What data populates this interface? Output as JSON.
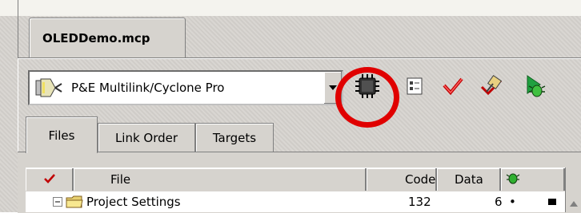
{
  "project_tab": {
    "label": "OLEDDemo.mcp"
  },
  "connection": {
    "selected": "P&E Multilink/Cyclone Pro"
  },
  "toolbar": {
    "buttons": [
      {
        "icon": "chip-icon",
        "label": ""
      },
      {
        "icon": "settings-list-icon",
        "label": ""
      },
      {
        "icon": "checkmark-icon",
        "label": ""
      },
      {
        "icon": "make-icon",
        "label": ""
      },
      {
        "icon": "debug-icon",
        "label": ""
      }
    ]
  },
  "tabs": [
    {
      "label": "Files",
      "active": true
    },
    {
      "label": "Link Order",
      "active": false
    },
    {
      "label": "Targets",
      "active": false
    }
  ],
  "table": {
    "columns": {
      "check": "",
      "file": "File",
      "code": "Code",
      "data": "Data"
    },
    "rows": [
      {
        "file": "Project Settings",
        "code": "132",
        "data": "6",
        "dot": "•"
      }
    ]
  },
  "colors": {
    "highlight_ring": "#e00000",
    "check_red": "#c00000"
  }
}
